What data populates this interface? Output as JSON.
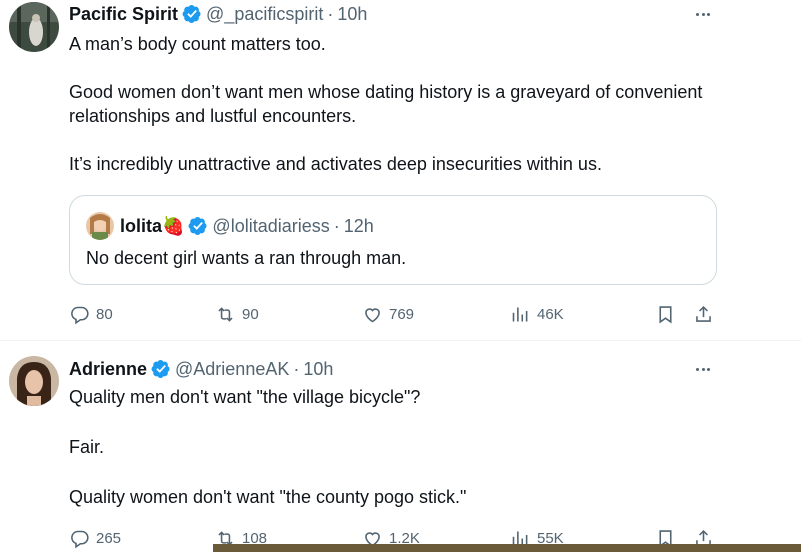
{
  "tweets": [
    {
      "name": "Pacific Spirit",
      "handle": "@_pacificspirit",
      "separator": "·",
      "time": "10h",
      "paragraphs": [
        "A man’s body count matters too.",
        "Good women don’t want men whose dating history is a graveyard of convenient relationships and lustful encounters.",
        "It’s incredibly unattractive and activates deep insecurities within us."
      ],
      "quote": {
        "name": "lolita🍓",
        "handle": "@lolitadiariess",
        "separator": "·",
        "time": "12h",
        "text": "No decent girl wants a ran through man."
      },
      "actions": {
        "replies": "80",
        "reposts": "90",
        "likes": "769",
        "views": "46K"
      }
    },
    {
      "name": "Adrienne",
      "handle": "@AdrienneAK",
      "separator": "·",
      "time": "10h",
      "paragraphs": [
        "Quality men don't want \"the village bicycle\"?",
        "Fair.",
        "Quality women don't want \"the county pogo stick.\""
      ],
      "actions": {
        "replies": "265",
        "reposts": "108",
        "likes": "1.2K",
        "views": "55K"
      }
    }
  ],
  "icons": {
    "verified": "verified-badge-icon",
    "more": "more-icon",
    "reply": "reply-icon",
    "repost": "repost-icon",
    "like": "like-icon",
    "views": "views-icon",
    "bookmark": "bookmark-icon",
    "share": "share-icon"
  },
  "colors": {
    "verified": "#1d9bf0",
    "secondary_text": "#536471",
    "text": "#0f1419",
    "border": "#cfd9de"
  }
}
